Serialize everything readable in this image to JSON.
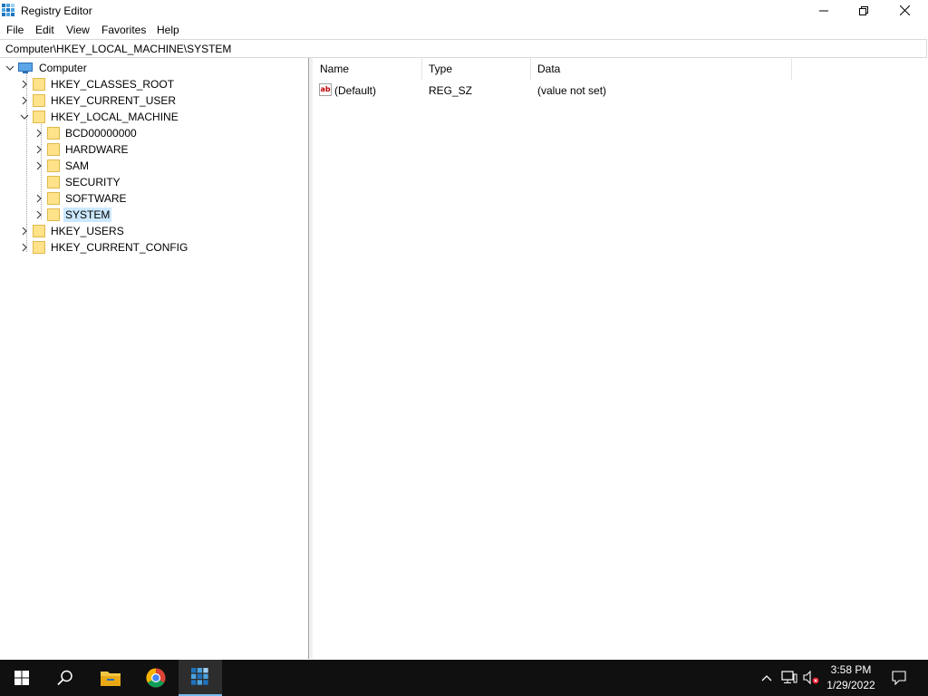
{
  "window": {
    "title": "Registry Editor",
    "controls": {
      "minimize": "minimize-icon",
      "maximize": "restore-icon",
      "close": "close-icon"
    }
  },
  "menu": [
    "File",
    "Edit",
    "View",
    "Favorites",
    "Help"
  ],
  "address": "Computer\\HKEY_LOCAL_MACHINE\\SYSTEM",
  "tree": {
    "root": "Computer",
    "hives": [
      "HKEY_CLASSES_ROOT",
      "HKEY_CURRENT_USER",
      "HKEY_LOCAL_MACHINE",
      "HKEY_USERS",
      "HKEY_CURRENT_CONFIG"
    ],
    "hklm_children": [
      "BCD00000000",
      "HARDWARE",
      "SAM",
      "SECURITY",
      "SOFTWARE",
      "SYSTEM"
    ],
    "selected": "SYSTEM"
  },
  "list": {
    "columns": [
      "Name",
      "Type",
      "Data"
    ],
    "rows": [
      {
        "name": "(Default)",
        "type": "REG_SZ",
        "data": "(value not set)"
      }
    ]
  },
  "taskbar": {
    "items": [
      "windows-start-icon",
      "search-icon",
      "file-explorer-icon",
      "chrome-icon",
      "registry-editor-icon"
    ],
    "time": "3:58 PM",
    "date": "1/29/2022",
    "accent": "#76b9ed"
  },
  "colors": {
    "selection": "#cce8ff",
    "folder": "#ffe28a",
    "taskbar": "#101010"
  }
}
